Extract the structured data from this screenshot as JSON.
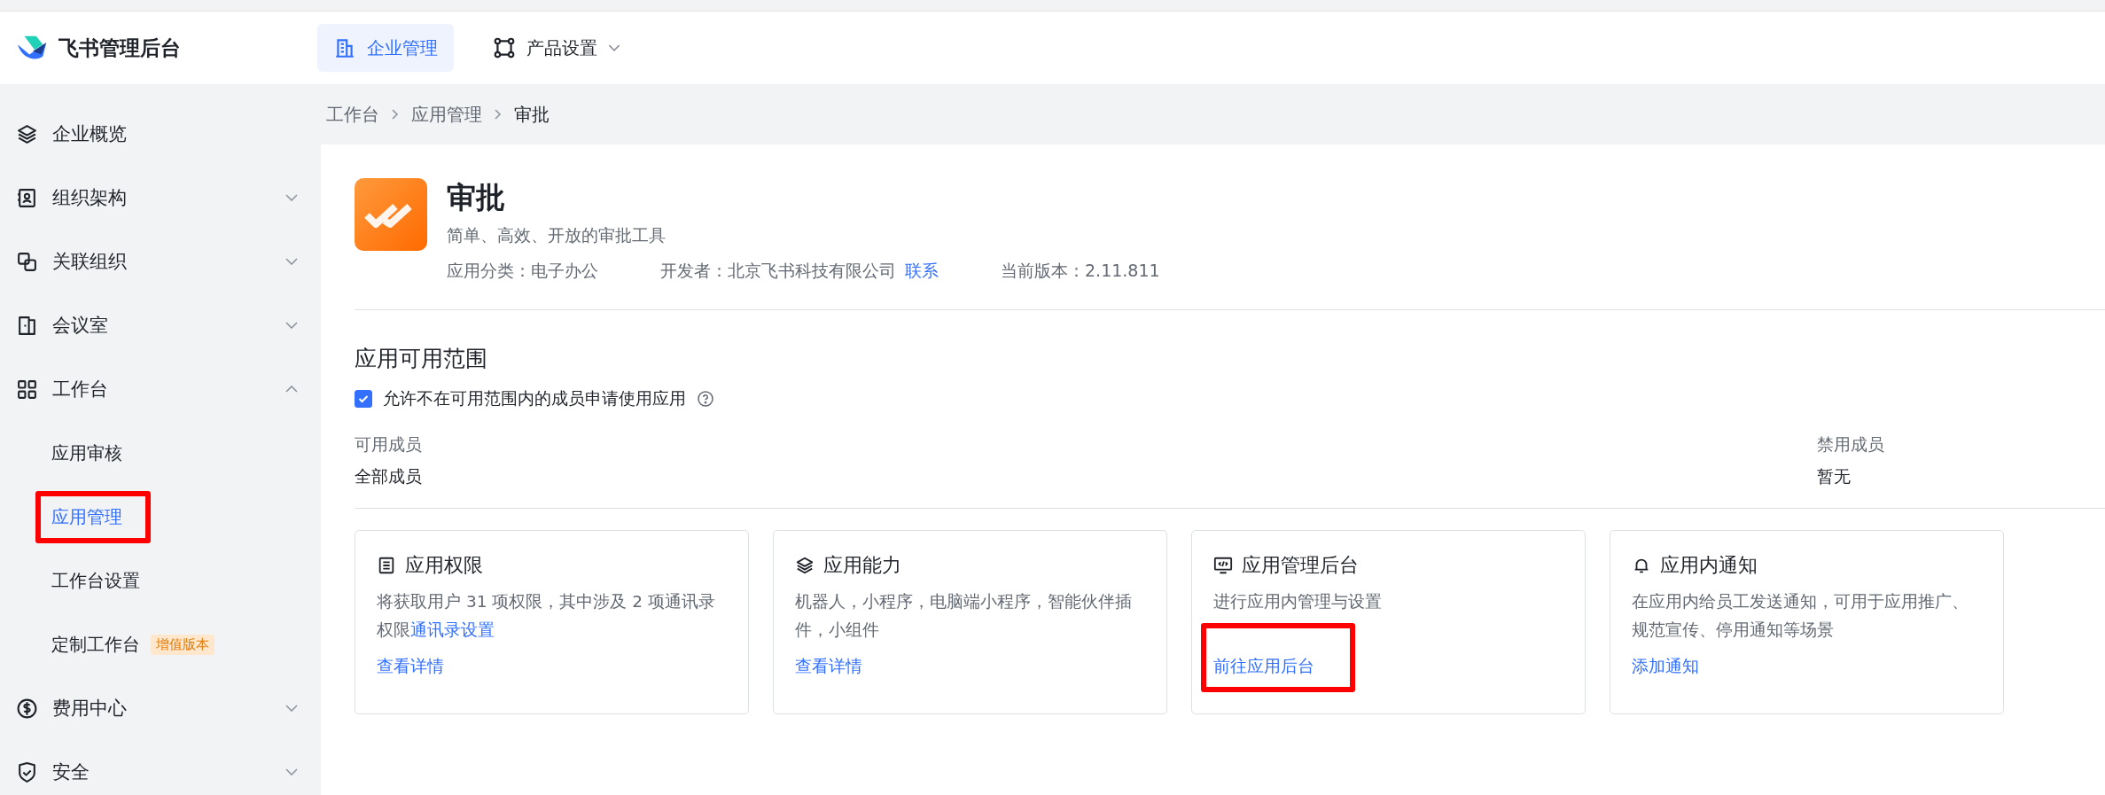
{
  "header": {
    "logo_text": "飞书管理后台",
    "nav": [
      {
        "label": "企业管理",
        "selected": true,
        "kind": "tab"
      },
      {
        "label": "产品设置",
        "selected": false,
        "kind": "menu"
      }
    ]
  },
  "sidebar": {
    "items": [
      {
        "label": "企业概览",
        "kind": "link"
      },
      {
        "label": "组织架构",
        "kind": "group",
        "expanded": false
      },
      {
        "label": "关联组织",
        "kind": "group",
        "expanded": false
      },
      {
        "label": "会议室",
        "kind": "group",
        "expanded": false
      },
      {
        "label": "工作台",
        "kind": "group",
        "expanded": true,
        "children": [
          {
            "label": "应用审核",
            "selected": false,
            "highlighted": false
          },
          {
            "label": "应用管理",
            "selected": true,
            "highlighted": true
          },
          {
            "label": "工作台设置",
            "selected": false,
            "highlighted": false
          },
          {
            "label": "定制工作台",
            "selected": false,
            "highlighted": false,
            "badge": "增值版本"
          }
        ]
      },
      {
        "label": "费用中心",
        "kind": "group",
        "expanded": false
      },
      {
        "label": "安全",
        "kind": "group",
        "expanded": false
      }
    ]
  },
  "breadcrumb": [
    "工作台",
    "应用管理",
    "审批"
  ],
  "app": {
    "name": "审批",
    "description": "简单、高效、开放的审批工具",
    "category": "应用分类：电子办公",
    "developer": "开发者：北京飞书科技有限公司",
    "contact_link": "联系",
    "version": "当前版本：2.11.811"
  },
  "scope": {
    "title": "应用可用范围",
    "allow_request": {
      "label": "允许不在可用范围内的成员申请使用应用",
      "checked": true
    },
    "available": {
      "label": "可用成员",
      "value": "全部成员"
    },
    "disabled": {
      "label": "禁用成员",
      "value": "暂无"
    }
  },
  "cards": [
    {
      "title": "应用权限",
      "text": "将获取用户 31 项权限，其中涉及 2 项通讯录权限",
      "inline_link": "通讯录设置",
      "link": "查看详情",
      "highlighted": false
    },
    {
      "title": "应用能力",
      "text": "机器人，小程序，电脑端小程序，智能伙伴插件，小组件",
      "link": "查看详情",
      "highlighted": false
    },
    {
      "title": "应用管理后台",
      "text": "进行应用内管理与设置",
      "link": "前往应用后台",
      "highlighted": true
    },
    {
      "title": "应用内通知",
      "text": "在应用内给员工发送通知，可用于应用推广、规范宣传、停用通知等场景",
      "link": "添加通知",
      "highlighted": false
    }
  ]
}
